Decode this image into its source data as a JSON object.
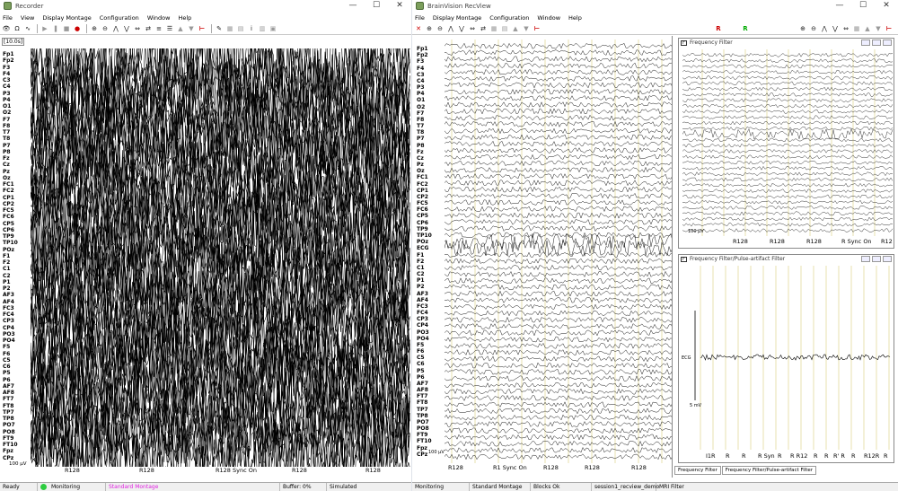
{
  "recorder": {
    "title": "Recorder",
    "menu": [
      "File",
      "View",
      "Display Montage",
      "Configuration",
      "Window",
      "Help"
    ],
    "scale": "[10.0s]",
    "channels": [
      "Fp1",
      "Fp2",
      "F3",
      "F4",
      "C3",
      "C4",
      "P3",
      "P4",
      "O1",
      "O2",
      "F7",
      "F8",
      "T7",
      "T8",
      "P7",
      "P8",
      "Fz",
      "Cz",
      "Pz",
      "Oz",
      "FC1",
      "FC2",
      "CP1",
      "CP2",
      "FC5",
      "FC6",
      "CP5",
      "CP6",
      "TP9",
      "TP10",
      "POz",
      "F1",
      "F2",
      "C1",
      "C2",
      "P1",
      "P2",
      "AF3",
      "AF4",
      "FC3",
      "FC4",
      "CP3",
      "CP4",
      "PO3",
      "PO4",
      "F5",
      "F6",
      "C5",
      "C6",
      "P5",
      "P6",
      "AF7",
      "AF8",
      "FT7",
      "FT8",
      "TP7",
      "TP8",
      "PO7",
      "PO8",
      "FT9",
      "FT10",
      "Fpz",
      "CPz"
    ],
    "scalebar": "100 µV",
    "markers": [
      "R128",
      "R128",
      "R128  Sync On",
      "R128",
      "R128"
    ],
    "status": {
      "ready": "Ready",
      "monitoring": "Monitoring",
      "montage": "Standard Montage",
      "buffer": "Buffer: 0%",
      "mode": "Simulated"
    },
    "status_colors": {
      "monitor_dot": "#2ecc40",
      "montage_text": "#e020e0"
    }
  },
  "recview": {
    "title": "BrainVision RecView",
    "menu": [
      "File",
      "Display Montage",
      "Configuration",
      "Window",
      "Help"
    ],
    "channels": [
      "Fp1",
      "Fp2",
      "F3",
      "F4",
      "C3",
      "C4",
      "P3",
      "P4",
      "O1",
      "O2",
      "F7",
      "F8",
      "T7",
      "T8",
      "P7",
      "P8",
      "Fz",
      "Cz",
      "Pz",
      "Oz",
      "FC1",
      "FC2",
      "CP1",
      "CP2",
      "FC5",
      "FC6",
      "CP5",
      "CP6",
      "TP9",
      "TP10",
      "POz",
      "ECG",
      "F1",
      "F2",
      "C1",
      "C2",
      "P1",
      "P2",
      "AF3",
      "AF4",
      "FC3",
      "FC4",
      "CP3",
      "CP4",
      "PO3",
      "PO4",
      "F5",
      "F6",
      "C5",
      "C6",
      "P5",
      "P6",
      "AF7",
      "AF8",
      "FT7",
      "FT8",
      "TP7",
      "TP8",
      "PO7",
      "PO8",
      "FT9",
      "FT10",
      "Fpz",
      "CPz"
    ],
    "scalebar": "100 µV",
    "markers": [
      "R128",
      "R1 Sync On",
      "R128",
      "R128",
      "R128"
    ],
    "status": [
      "Monitoring",
      "Standard Montage",
      "Blocks Ok",
      "session1_recview_demo",
      "MRI Filter"
    ],
    "freq_filter": {
      "title": "Frequency Filter",
      "scalebar": "100 µV",
      "markers": [
        "R128",
        "R128",
        "R128",
        "R  Sync On",
        "R12"
      ]
    },
    "pulse_filter": {
      "title": "Frequency Filter/Pulse-artifact Filter",
      "channel": "ECG",
      "scalebar": "5 mV",
      "markers": [
        "I1R",
        "R",
        "R",
        "R  Syn",
        "R",
        "R R12",
        "R",
        "R",
        "R' R",
        "R",
        "R12R",
        "R"
      ]
    },
    "tabs": [
      "Frequency Filter",
      "Frequency Filter/Pulse-artifact Filter"
    ]
  }
}
